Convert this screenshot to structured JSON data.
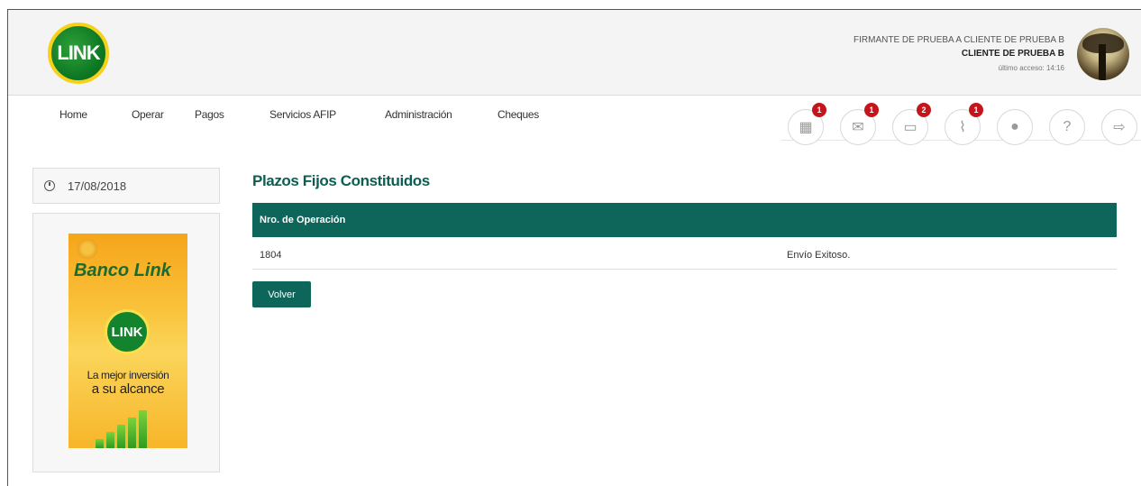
{
  "header": {
    "logo_text": "LINK",
    "user_line1": "FIRMANTE DE PRUEBA A CLIENTE DE PRUEBA B",
    "user_line2": "CLIENTE DE PRUEBA B",
    "last_access": "último acceso: 14:16"
  },
  "nav": {
    "items": [
      "Home",
      "Operar",
      "Pagos",
      "Servicios AFIP",
      "Administración",
      "Cheques"
    ]
  },
  "toolbar": {
    "icons": [
      {
        "name": "calculator-icon",
        "glyph": "▦",
        "badge": "1"
      },
      {
        "name": "mail-icon",
        "glyph": "✉",
        "badge": "1"
      },
      {
        "name": "folder-icon",
        "glyph": "▭",
        "badge": "2"
      },
      {
        "name": "paperclip-icon",
        "glyph": "⌇",
        "badge": "1"
      },
      {
        "name": "user-icon",
        "glyph": "●",
        "badge": ""
      },
      {
        "name": "help-icon",
        "glyph": "?",
        "badge": ""
      },
      {
        "name": "logout-icon",
        "glyph": "⇨",
        "badge": ""
      }
    ]
  },
  "sidebar": {
    "date": "17/08/2018",
    "banner_title": "Banco Link",
    "banner_logo": "LINK",
    "banner_line1": "La mejor inversión",
    "banner_line2": "a su alcance"
  },
  "main": {
    "title": "Plazos Fijos Constituidos",
    "table_header": "Nro. de Operación",
    "rows": [
      {
        "operation": "1804",
        "status": "Envío Exitoso."
      }
    ],
    "back_button": "Volver"
  },
  "colors": {
    "brand_green": "#0e665a",
    "badge_red": "#c4151c",
    "logo_yellow": "#f7d117"
  }
}
